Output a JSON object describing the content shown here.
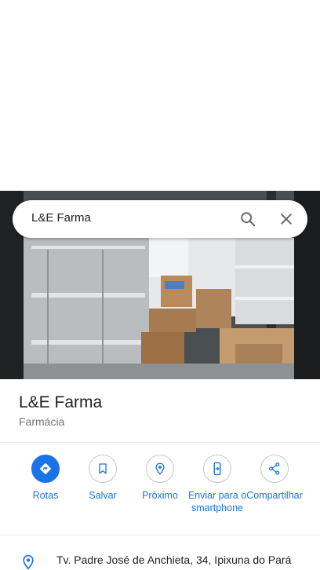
{
  "search": {
    "query": "L&E Farma"
  },
  "place": {
    "name": "L&E Farma",
    "category": "Farmácia",
    "address": "Tv. Padre José de Anchieta, 34, Ipixuna do Pará"
  },
  "actions": [
    {
      "label": "Rotas",
      "icon": "directions-icon"
    },
    {
      "label": "Salvar",
      "icon": "bookmark-icon"
    },
    {
      "label": "Próximo",
      "icon": "nearby-icon"
    },
    {
      "label": "Enviar para o smartphone",
      "icon": "send-to-phone-icon"
    },
    {
      "label": "Compartilhar",
      "icon": "share-icon"
    }
  ],
  "colors": {
    "accent": "#1a73e8",
    "secondary_text": "#70757a"
  }
}
